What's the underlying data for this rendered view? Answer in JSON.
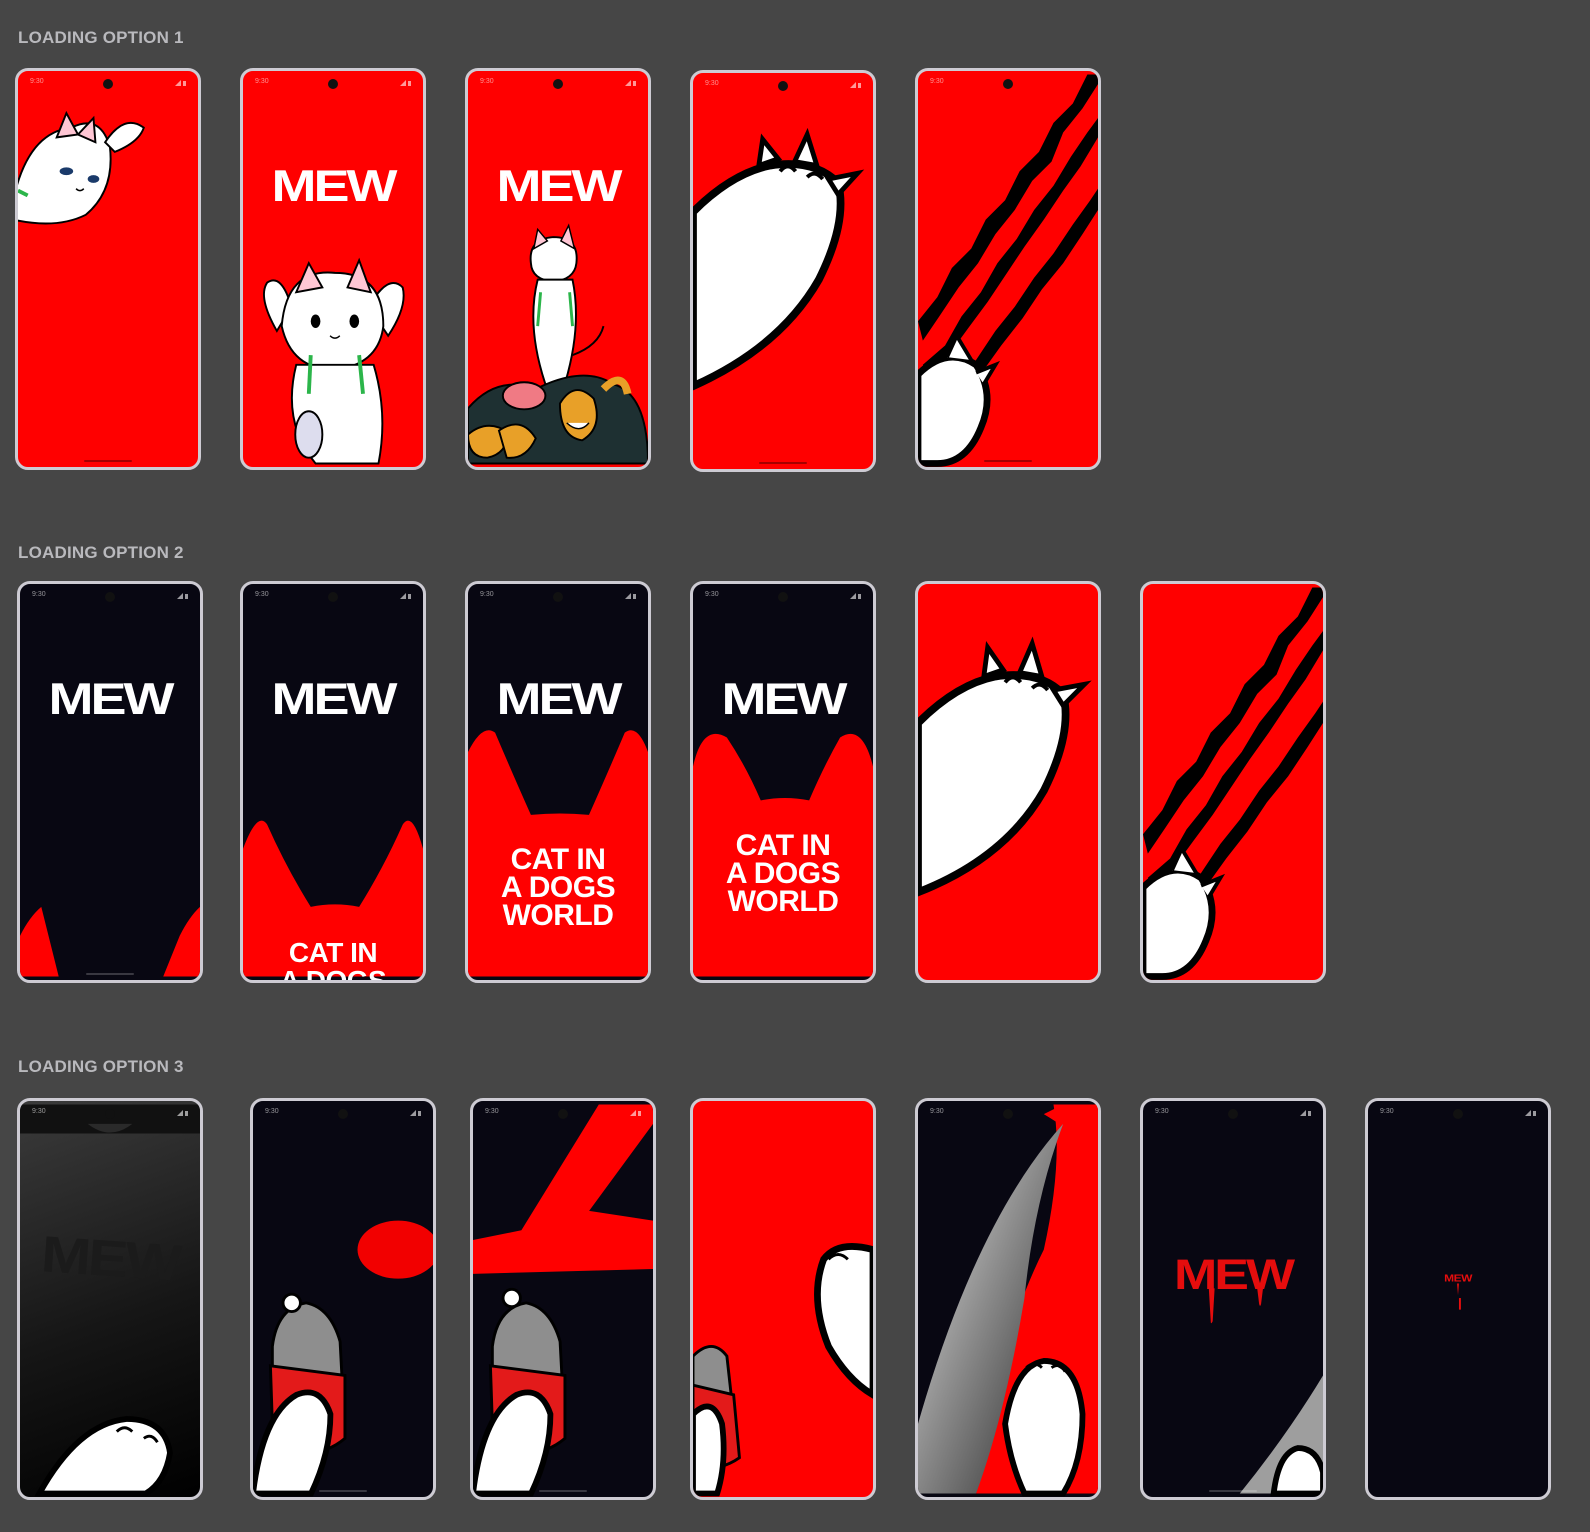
{
  "sections": [
    {
      "title": "LOADING OPTION 1"
    },
    {
      "title": "LOADING OPTION 2"
    },
    {
      "title": "LOADING OPTION 3"
    }
  ],
  "screen": {
    "time": "9:30"
  },
  "logo": "MEW",
  "tagline": {
    "line1": "CAT IN",
    "line2": "A DOGS",
    "line3": "WORLD"
  },
  "colors": {
    "red": "#ff0000",
    "navy": "#080712",
    "frame": "#cdcbd3",
    "canvas": "#464646",
    "label": "#b9b9bd"
  }
}
